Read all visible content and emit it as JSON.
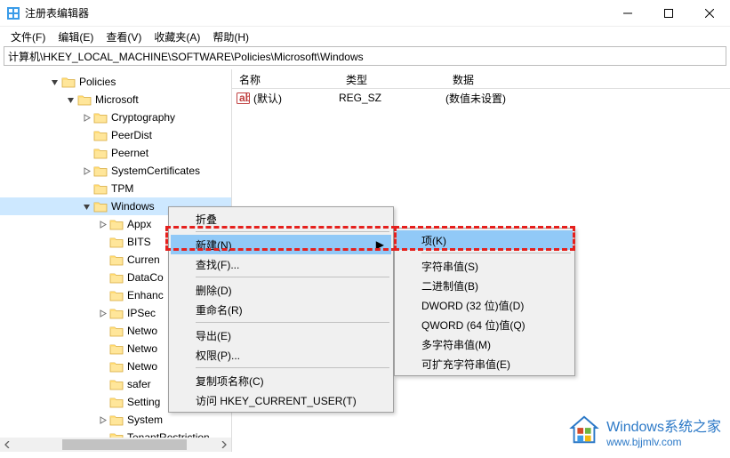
{
  "window": {
    "title": "注册表编辑器"
  },
  "titlebar": {
    "min": "minimize",
    "max": "maximize",
    "close": "close"
  },
  "menubar": {
    "file": "文件(F)",
    "edit": "编辑(E)",
    "view": "查看(V)",
    "favorites": "收藏夹(A)",
    "help": "帮助(H)"
  },
  "addressbar": {
    "path": "计算机\\HKEY_LOCAL_MACHINE\\SOFTWARE\\Policies\\Microsoft\\Windows"
  },
  "list": {
    "columns": {
      "name": "名称",
      "type": "类型",
      "data": "数据"
    },
    "rows": [
      {
        "name": "(默认)",
        "type": "REG_SZ",
        "data": "(数值未设置)"
      }
    ]
  },
  "tree": {
    "items": [
      {
        "indent": 54,
        "expander": "open",
        "label": "Policies"
      },
      {
        "indent": 72,
        "expander": "open",
        "label": "Microsoft"
      },
      {
        "indent": 90,
        "expander": "closed",
        "label": "Cryptography"
      },
      {
        "indent": 90,
        "expander": "none",
        "label": "PeerDist"
      },
      {
        "indent": 90,
        "expander": "none",
        "label": "Peernet"
      },
      {
        "indent": 90,
        "expander": "closed",
        "label": "SystemCertificates"
      },
      {
        "indent": 90,
        "expander": "none",
        "label": "TPM"
      },
      {
        "indent": 90,
        "expander": "open",
        "label": "Windows",
        "selected": true
      },
      {
        "indent": 108,
        "expander": "closed",
        "label": "Appx"
      },
      {
        "indent": 108,
        "expander": "none",
        "label": "BITS"
      },
      {
        "indent": 108,
        "expander": "none",
        "label": "Curren"
      },
      {
        "indent": 108,
        "expander": "none",
        "label": "DataCo"
      },
      {
        "indent": 108,
        "expander": "none",
        "label": "Enhanc"
      },
      {
        "indent": 108,
        "expander": "closed",
        "label": "IPSec"
      },
      {
        "indent": 108,
        "expander": "none",
        "label": "Netwo"
      },
      {
        "indent": 108,
        "expander": "none",
        "label": "Netwo"
      },
      {
        "indent": 108,
        "expander": "none",
        "label": "Netwo"
      },
      {
        "indent": 108,
        "expander": "none",
        "label": "safer"
      },
      {
        "indent": 108,
        "expander": "none",
        "label": "Setting"
      },
      {
        "indent": 108,
        "expander": "closed",
        "label": "System"
      },
      {
        "indent": 108,
        "expander": "none",
        "label": "TenantRestriction"
      }
    ]
  },
  "ctx1": {
    "collapse": "折叠",
    "new": "新建(N)",
    "find": "查找(F)...",
    "delete": "删除(D)",
    "rename": "重命名(R)",
    "export": "导出(E)",
    "permissions": "权限(P)...",
    "copykey": "复制项名称(C)",
    "go_hkcu": "访问 HKEY_CURRENT_USER(T)"
  },
  "ctx2": {
    "key": "项(K)",
    "string": "字符串值(S)",
    "binary": "二进制值(B)",
    "dword": "DWORD (32 位)值(D)",
    "qword": "QWORD (64 位)值(Q)",
    "multistring": "多字符串值(M)",
    "expandstring": "可扩充字符串值(E)"
  },
  "watermark": {
    "main": "Windows系统之家",
    "sub": "www.bjjmlv.com"
  }
}
